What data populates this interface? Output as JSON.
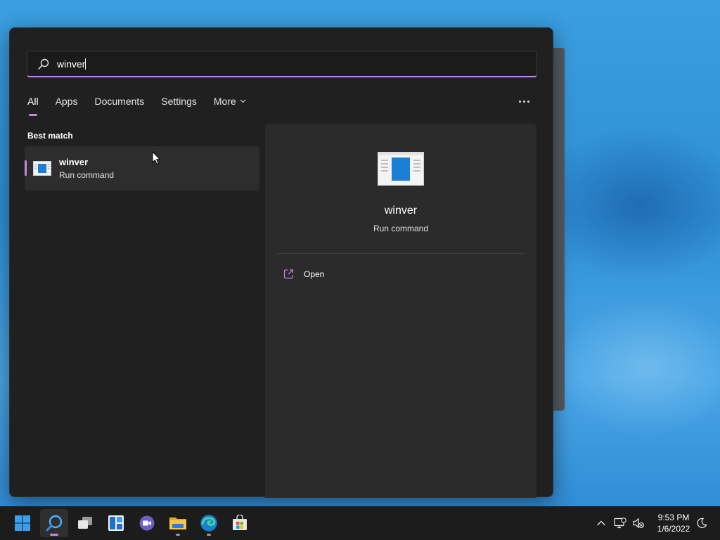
{
  "search": {
    "query": "winver"
  },
  "tabs": [
    {
      "label": "All",
      "active": true
    },
    {
      "label": "Apps"
    },
    {
      "label": "Documents"
    },
    {
      "label": "Settings"
    },
    {
      "label": "More"
    }
  ],
  "best_match": {
    "section_label": "Best match",
    "item": {
      "name": "winver",
      "subtitle": "Run command",
      "icon": "winver-app-icon"
    }
  },
  "detail": {
    "name": "winver",
    "subtitle": "Run command",
    "icon": "winver-app-icon",
    "actions": [
      {
        "label": "Open",
        "icon": "open-external-icon"
      }
    ]
  },
  "taskbar": {
    "apps": [
      "start-windows-icon",
      "search-icon",
      "task-view-icon",
      "widgets-icon",
      "teams-chat-icon",
      "file-explorer-icon",
      "edge-browser-icon",
      "microsoft-store-icon"
    ],
    "tray": [
      "chevron-up-icon",
      "network-icon",
      "volume-muted-icon"
    ],
    "time": "9:53 PM",
    "date": "1/6/2022"
  },
  "colors": {
    "accent": "#c586e8",
    "panel_bg": "#202020",
    "detail_bg": "#2b2b2b",
    "taskbar_bg": "#1c1c1c"
  }
}
